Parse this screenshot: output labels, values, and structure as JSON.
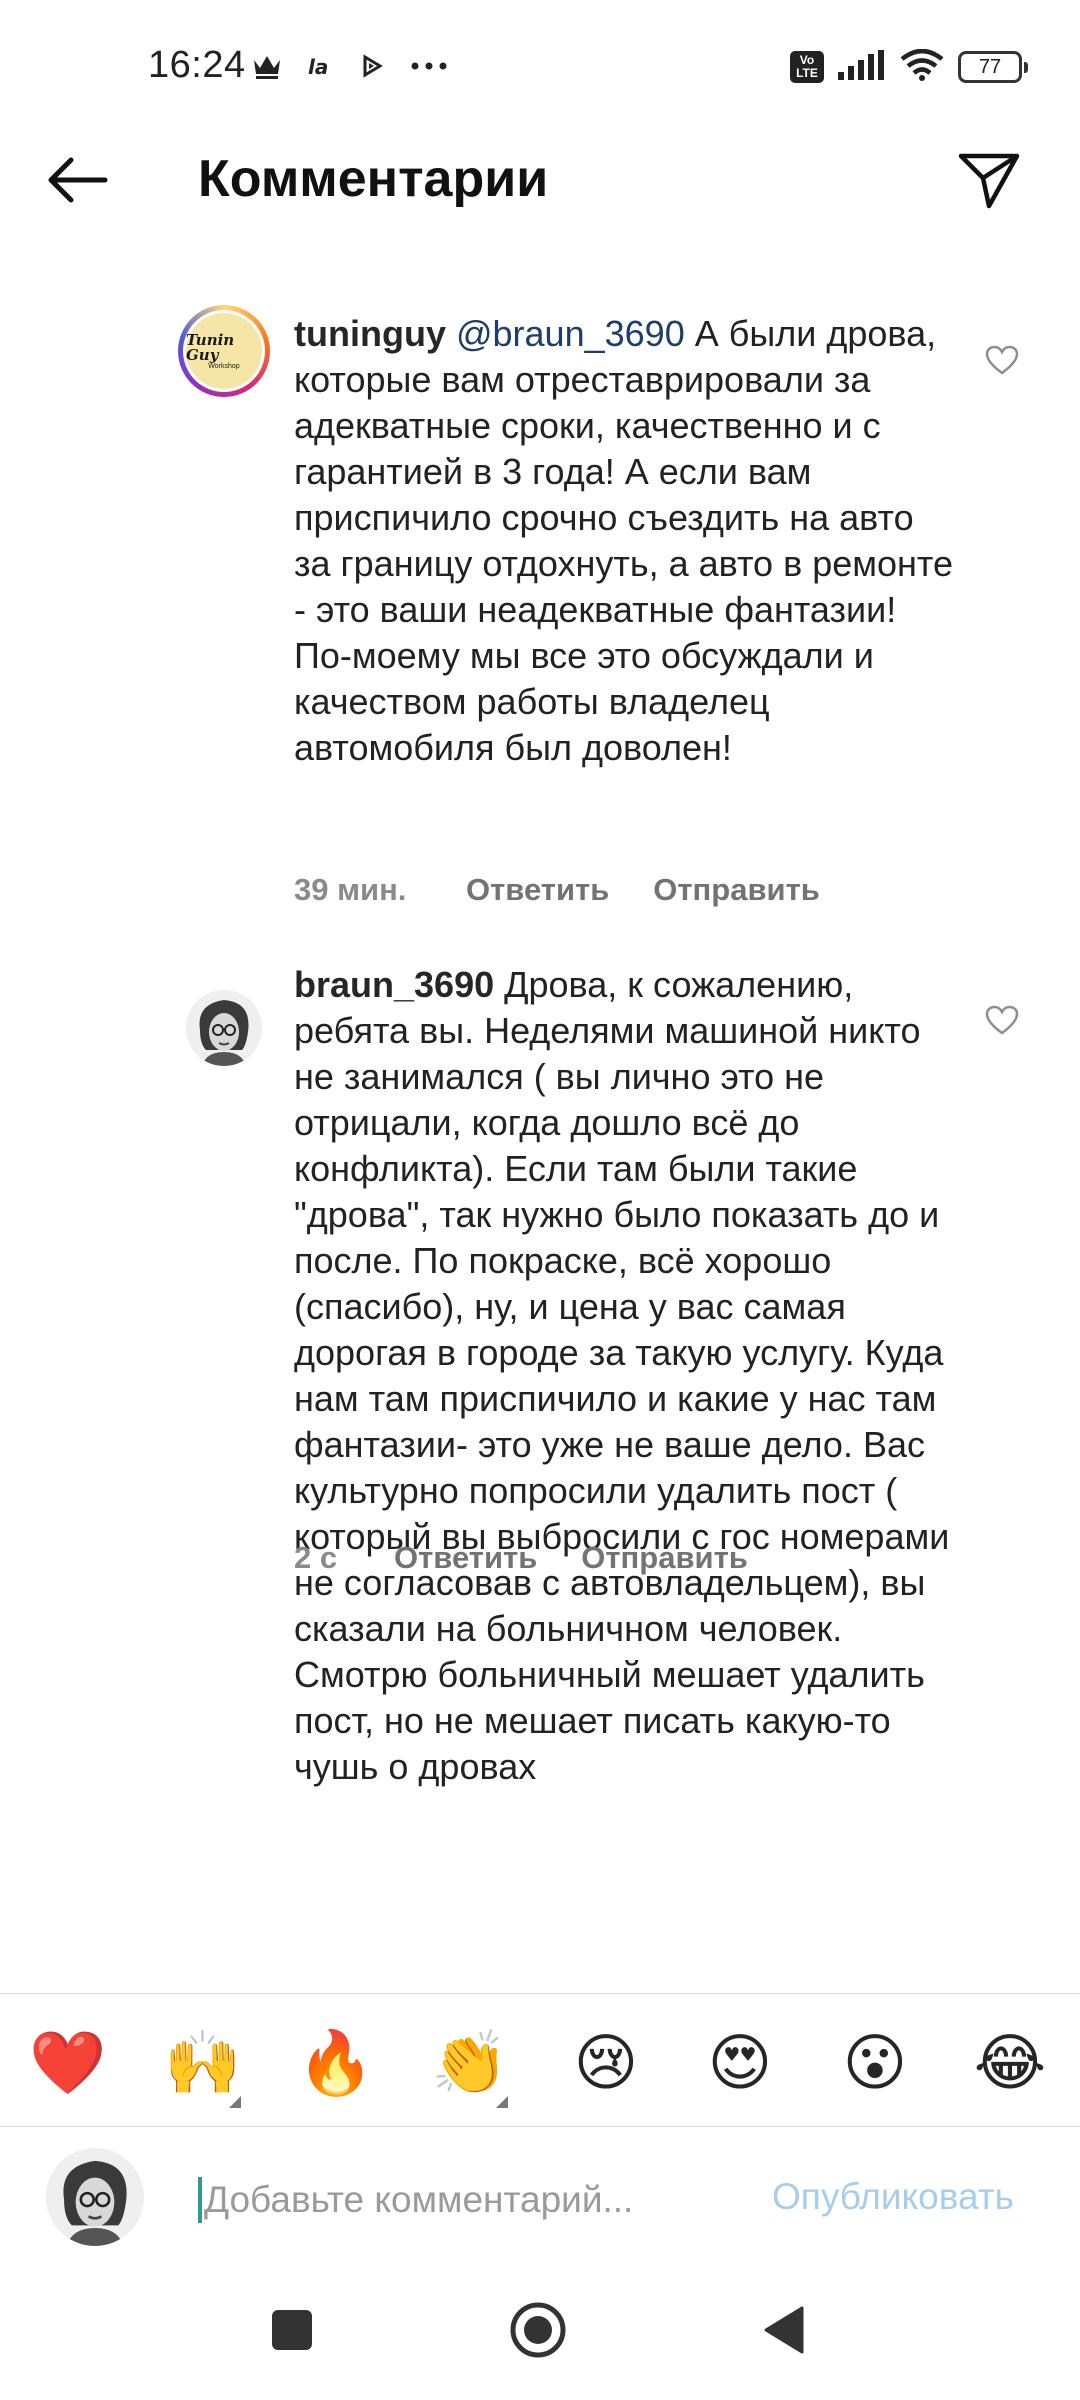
{
  "status_bar": {
    "time": "16:24",
    "left_icons": [
      "crown-icon",
      "la-icon",
      "play-icon",
      "more-dots-icon"
    ],
    "volte_label": "Vo\nLTE",
    "battery_level": "77"
  },
  "header": {
    "title": "Комментарии",
    "back_icon": "arrow-left-icon",
    "share_icon": "paper-plane-icon"
  },
  "comments": [
    {
      "username": "tuninguy",
      "mention": "@braun_3690",
      "text": "А были дрова, которые вам отреставрировали за адекватные сроки, качественно и с гарантией в 3 года! А если вам приспичило срочно съездить на авто за границу отдохнуть, а авто в ремонте - это ваши неадекватные фантазии! По-моему мы все это обсуждали и качеством работы владелец автомобиля был доволен!",
      "avatar_text": "Tunin Guy",
      "avatar_subtext": "Workshop",
      "time": "39 мин.",
      "reply_label": "Ответить",
      "send_label": "Отправить"
    },
    {
      "username": "braun_3690",
      "text": "Дрова, к сожалению, ребята вы. Неделями машиной никто не занимался ( вы лично это не отрицали, когда дошло всё до конфликта). Если там были такие \"дрова\", так нужно было показать до и после. По покраске, всё хорошо (спасибо), ну, и цена у вас самая дорогая в городе за такую услугу. Куда нам там приспичило и какие у нас там фантазии- это уже не ваше дело. Вас культурно попросили удалить пост ( который вы выбросили с гос номерами не согласовав с автовладельцем), вы сказали на больничном человек. Смотрю больничный мешает удалить пост, но не мешает писать какую-то чушь о дровах",
      "time": "2 с",
      "reply_label": "Ответить",
      "send_label": "Отправить"
    }
  ],
  "emoji_bar": [
    "❤️",
    "🙌",
    "🔥",
    "👏",
    "😢",
    "😍",
    "😮",
    "😂"
  ],
  "input": {
    "placeholder": "Добавьте комментарий...",
    "publish_label": "Опубликовать"
  },
  "nav_bar": [
    "recent-apps-icon",
    "home-icon",
    "back-triangle-icon"
  ],
  "colors": {
    "mention": "#1c3d6e",
    "publish_disabled": "#a8cdec",
    "meta_gray": "#737373",
    "caret": "#2a9d8f"
  }
}
